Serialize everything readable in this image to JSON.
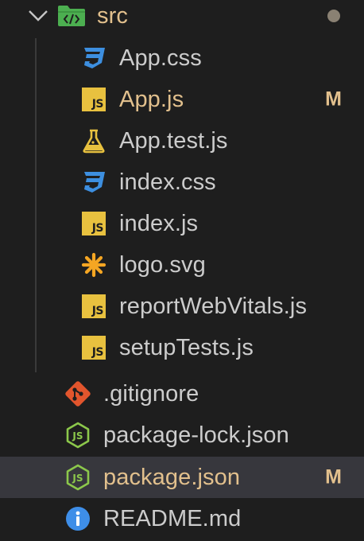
{
  "explorer": {
    "folder": {
      "label": "src",
      "icon": "folder-src-icon",
      "expanded": true,
      "status": "modified-dot"
    },
    "src_files": [
      {
        "label": "App.css",
        "icon": "css-icon",
        "badge": ""
      },
      {
        "label": "App.js",
        "icon": "js-icon",
        "badge": "M"
      },
      {
        "label": "App.test.js",
        "icon": "test-flask-icon",
        "badge": ""
      },
      {
        "label": "index.css",
        "icon": "css-icon",
        "badge": ""
      },
      {
        "label": "index.js",
        "icon": "js-icon",
        "badge": ""
      },
      {
        "label": "logo.svg",
        "icon": "svg-asterisk-icon",
        "badge": ""
      },
      {
        "label": "reportWebVitals.js",
        "icon": "js-icon",
        "badge": ""
      },
      {
        "label": "setupTests.js",
        "icon": "js-icon",
        "badge": ""
      }
    ],
    "root_files": [
      {
        "label": ".gitignore",
        "icon": "git-icon",
        "badge": ""
      },
      {
        "label": "package-lock.json",
        "icon": "nodejs-icon",
        "badge": ""
      },
      {
        "label": "package.json",
        "icon": "nodejs-icon",
        "badge": "M",
        "selected": true
      },
      {
        "label": "README.md",
        "icon": "info-icon",
        "badge": ""
      }
    ]
  },
  "colors": {
    "background": "#1e1e1e",
    "selected_row": "#37373d",
    "modified_text": "#e2c08d",
    "css_icon": "#3d8fe0",
    "js_icon": "#e8c13f",
    "git_icon": "#e2552d",
    "node_icon": "#8cc84b",
    "info_icon": "#3e8ee8",
    "folder_icon": "#4caf50"
  }
}
